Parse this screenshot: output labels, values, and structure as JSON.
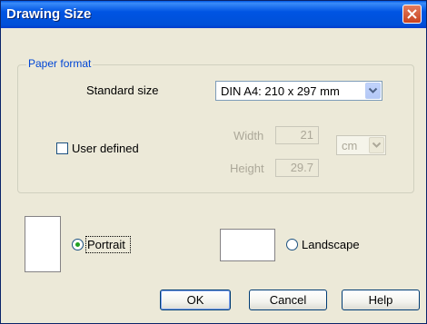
{
  "window": {
    "title": "Drawing Size"
  },
  "paper_format": {
    "legend": "Paper format",
    "standard_size_label": "Standard size",
    "standard_size_value": "DIN A4: 210 x  297 mm",
    "user_defined_label": "User defined",
    "user_defined_checked": false,
    "width_label": "Width",
    "width_value": "21",
    "height_label": "Height",
    "height_value": "29.7",
    "unit_value": "cm"
  },
  "orientation": {
    "portrait_label": "Portrait",
    "portrait_selected": true,
    "landscape_label": "Landscape",
    "landscape_selected": false
  },
  "buttons": {
    "ok": "OK",
    "cancel": "Cancel",
    "help": "Help"
  },
  "icons": {
    "close": "close-icon",
    "dropdown": "chevron-down-icon"
  },
  "colors": {
    "title_bar": "#0054e3",
    "accent_legend": "#0046d5",
    "radio_dot": "#21a121",
    "close_button": "#d9552f"
  }
}
